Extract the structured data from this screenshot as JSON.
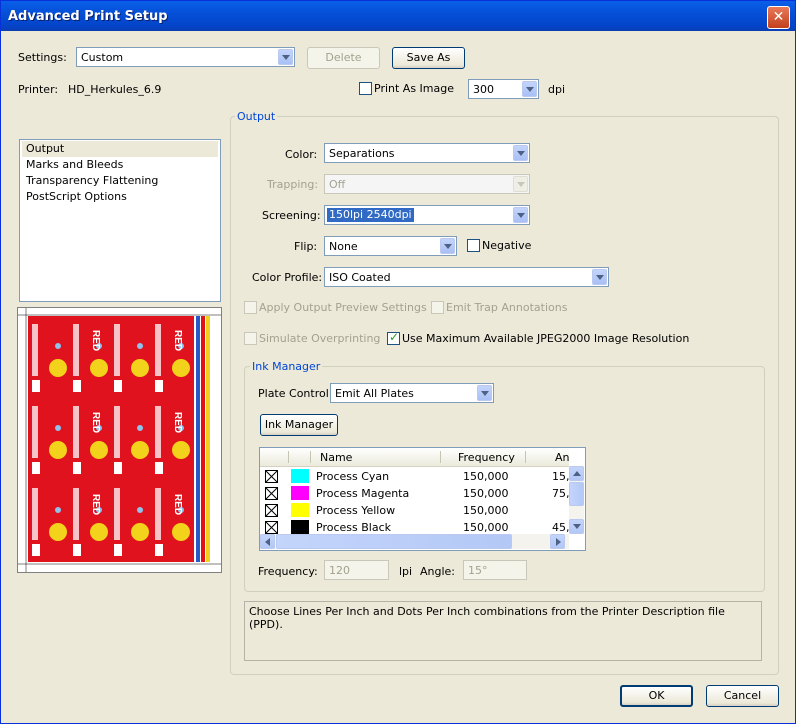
{
  "window": {
    "title": "Advanced Print Setup",
    "close_glyph": "✕"
  },
  "settings": {
    "label": "Settings:",
    "value": "Custom",
    "delete_label": "Delete",
    "save_as_label": "Save As"
  },
  "printer": {
    "label": "Printer:",
    "value": "HD_Herkules_6.9",
    "print_as_image_label": "Print As Image",
    "print_as_image_checked": false,
    "dpi_value": "300",
    "dpi_unit": "dpi"
  },
  "nav": {
    "items": [
      "Output",
      "Marks and Bleeds",
      "Transparency Flattening",
      "PostScript Options"
    ],
    "selected": "Output"
  },
  "output": {
    "group_title": "Output",
    "color_label": "Color:",
    "color_value": "Separations",
    "trapping_label": "Trapping:",
    "trapping_value": "Off",
    "screening_label": "Screening:",
    "screening_value": "150lpi 2540dpi",
    "flip_label": "Flip:",
    "flip_value": "None",
    "negative_label": "Negative",
    "negative_checked": false,
    "color_profile_label": "Color Profile:",
    "color_profile_value": "ISO Coated",
    "apply_preview_label": "Apply Output Preview Settings",
    "emit_trap_label": "Emit Trap Annotations",
    "simulate_overprint_label": "Simulate Overprinting",
    "use_max_jpeg_label": "Use Maximum Available JPEG2000 Image Resolution",
    "use_max_jpeg_checked": true
  },
  "ink_manager": {
    "group_title": "Ink Manager",
    "plate_control_label": "Plate Control",
    "plate_control_value": "Emit All Plates",
    "button_label": "Ink Manager",
    "columns": [
      "Name",
      "Frequency",
      "An"
    ],
    "rows": [
      {
        "name": "Process Cyan",
        "frequency": "150,000",
        "angle": "15,",
        "color": "#00ffff"
      },
      {
        "name": "Process Magenta",
        "frequency": "150,000",
        "angle": "75,",
        "color": "#ff00ff"
      },
      {
        "name": "Process Yellow",
        "frequency": "150,000",
        "angle": "",
        "color": "#ffff00"
      },
      {
        "name": "Process Black",
        "frequency": "150,000",
        "angle": "45,",
        "color": "#000000"
      }
    ],
    "frequency_label": "Frequency:",
    "frequency_value": "120",
    "lpi_unit": "lpi",
    "angle_label": "Angle:",
    "angle_value": "15°"
  },
  "description": "Choose Lines Per Inch and Dots Per Inch combinations from the Printer Description file (PPD).",
  "footer": {
    "ok_label": "OK",
    "cancel_label": "Cancel"
  },
  "preview": {
    "brand_text": "RED",
    "accent_color": "#e0121d"
  }
}
